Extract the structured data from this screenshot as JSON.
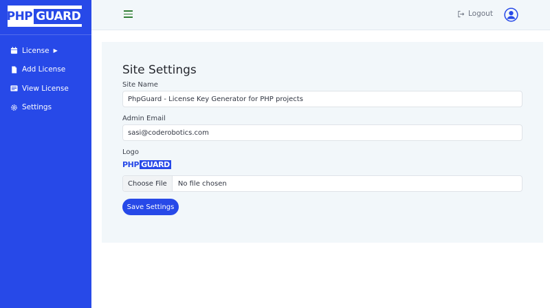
{
  "brand": {
    "php": "PHP",
    "guard": "GUARD"
  },
  "sidebar": {
    "items": [
      {
        "icon": "calendar-icon",
        "label": "License",
        "has_caret": true
      },
      {
        "icon": "file-icon",
        "label": "Add License"
      },
      {
        "icon": "list-card-icon",
        "label": "View License"
      },
      {
        "icon": "gear-icon",
        "label": "Settings"
      }
    ]
  },
  "topbar": {
    "logout_label": "Logout"
  },
  "main": {
    "title": "Site Settings",
    "site_name_label": "Site Name",
    "site_name_value": "PhpGuard - License Key Generator for PHP projects",
    "admin_email_label": "Admin Email",
    "admin_email_value": "sasi@coderobotics.com",
    "logo_label": "Logo",
    "choose_file_label": "Choose File",
    "file_status": "No file chosen",
    "save_label": "Save Settings"
  },
  "colors": {
    "accent": "#2749e8",
    "topbar_bg": "#f2f7fa",
    "hamburger": "#2e7d32"
  }
}
